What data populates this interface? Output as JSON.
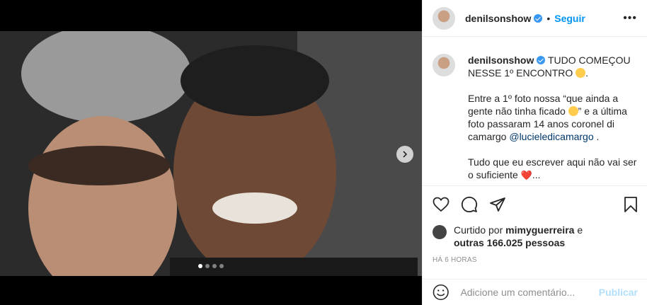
{
  "post": {
    "carousel_dots": 4,
    "active_dot": 0
  },
  "header": {
    "username": "denilsonshow",
    "separator": "•",
    "follow_label": "Seguir",
    "more_label": "•••"
  },
  "caption": {
    "username": "denilsonshow",
    "line1": "TUDO COMEÇOU NESSE 1º ENCONTRO",
    "line1_end": ".",
    "p2_part1": "Entre a 1º foto nossa “que ainda a gente não tinha ficado",
    "p2_part2": "” e a última foto passaram 14 anos coronel di camargo",
    "mention": "@lucieledicamargo",
    "mention_after": ".",
    "p3": "Tudo que eu escrever aqui não vai ser o suficiente",
    "p3_end": "..."
  },
  "likes": {
    "prefix": "Curtido por",
    "user": "mimyguerreira",
    "conj": "e",
    "others": "outras 166.025 pessoas"
  },
  "timestamp": "HÁ 6 HORAS",
  "comment": {
    "placeholder": "Adicione um comentário...",
    "publish_label": "Publicar"
  },
  "icons": {
    "like": "heart-icon",
    "comment": "comment-icon",
    "share": "share-icon",
    "save": "bookmark-icon",
    "emoji": "emoji-icon",
    "next": "chevron-right-icon"
  },
  "colors": {
    "link": "#0095f6",
    "mention": "#00376b",
    "muted": "#8e8e8e",
    "publish_disabled": "#b2dffc"
  }
}
